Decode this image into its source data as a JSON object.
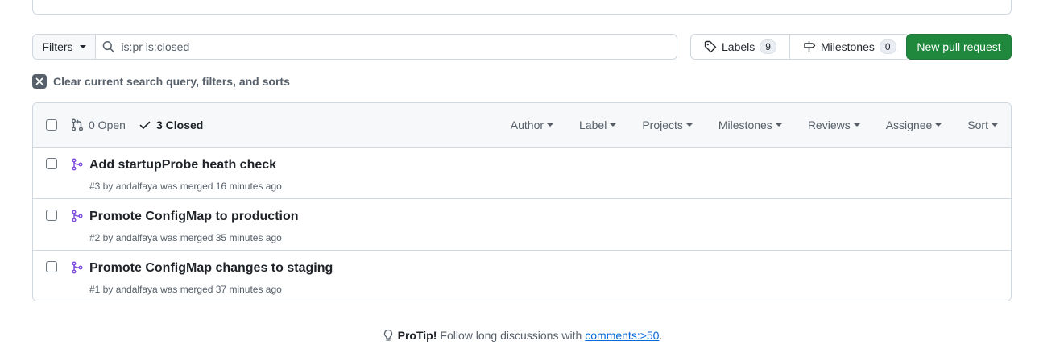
{
  "filter_bar": {
    "filters_label": "Filters",
    "search_value": "is:pr is:closed"
  },
  "labels_button": {
    "label": "Labels",
    "count": "9"
  },
  "milestones_button": {
    "label": "Milestones",
    "count": "0"
  },
  "new_pr_label": "New pull request",
  "clear_label": "Clear current search query, filters, and sorts",
  "list_header": {
    "open_label": "0 Open",
    "closed_label": "3 Closed",
    "sorts": [
      "Author",
      "Label",
      "Projects",
      "Milestones",
      "Reviews",
      "Assignee",
      "Sort"
    ]
  },
  "pull_requests": [
    {
      "title": "Add startupProbe heath check",
      "meta": "#3 by andalfaya was merged 16 minutes ago"
    },
    {
      "title": "Promote ConfigMap to production",
      "meta": "#2 by andalfaya was merged 35 minutes ago"
    },
    {
      "title": "Promote ConfigMap changes to staging",
      "meta": "#1 by andalfaya was merged 37 minutes ago"
    }
  ],
  "protip": {
    "label": "ProTip!",
    "text": "Follow long discussions with",
    "link": "comments:>50",
    "end": "."
  },
  "colors": {
    "primary_green": "#1f883d",
    "merged_purple": "#8250df",
    "link_blue": "#0969da"
  }
}
